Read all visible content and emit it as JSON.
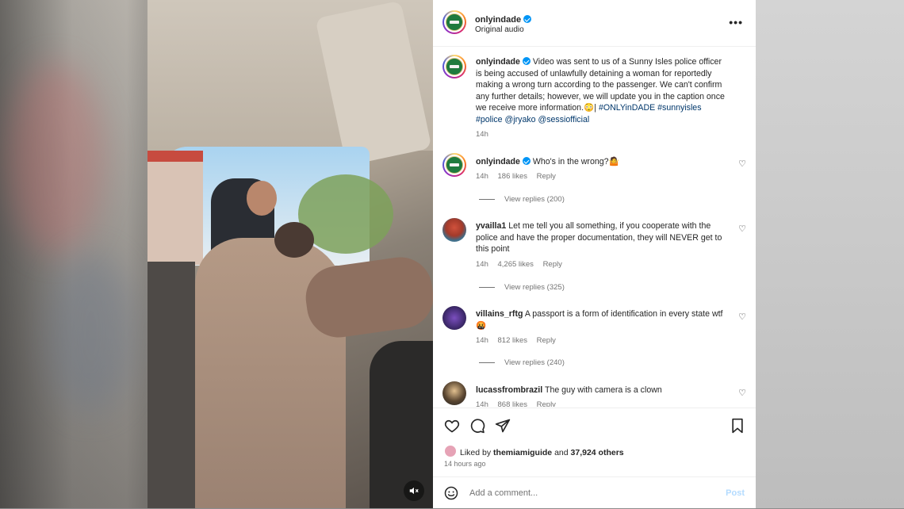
{
  "post": {
    "username": "onlyindade",
    "audio": "Original audio",
    "caption_user": "onlyindade",
    "caption_text": "Video was sent to us of a Sunny Isles police officer is being accused of unlawfully detaining a woman for reportedly making a wrong turn according to the passenger. We can't confirm any further details; however, we will update you in the caption once we receive more information.",
    "caption_emoji": "😳",
    "caption_sep": "|",
    "caption_tags": "#ONLYinDADE",
    "caption_tags2": "#sunnyisles #police @jryako @sessiofficial",
    "caption_time": "14h"
  },
  "comments": [
    {
      "user": "onlyindade",
      "verified": true,
      "text": "Who's in the wrong?🤷",
      "time": "14h",
      "likes": "186 likes",
      "reply": "Reply",
      "view_replies": "View replies (200)"
    },
    {
      "user": "yvailla1",
      "verified": false,
      "text": "Let me tell you all something, if you cooperate with the police and have the proper documentation, they will NEVER get to this point",
      "time": "14h",
      "likes": "4,265 likes",
      "reply": "Reply",
      "view_replies": "View replies (325)"
    },
    {
      "user": "villains_rftg",
      "verified": false,
      "text": "A passport is a form of identification in every state wtf 🤬",
      "time": "14h",
      "likes": "812 likes",
      "reply": "Reply",
      "view_replies": "View replies (240)"
    },
    {
      "user": "lucassfrombrazil",
      "verified": false,
      "text": "The guy with camera is a clown",
      "time": "14h",
      "likes": "868 likes",
      "reply": "Reply"
    }
  ],
  "likes": {
    "prefix": "Liked by",
    "user": "themiamiguide",
    "and": "and",
    "others": "37,924 others"
  },
  "posted": "14 hours ago",
  "add_comment": {
    "placeholder": "Add a comment...",
    "post": "Post"
  },
  "icons": {
    "more": "more-options-icon",
    "like": "heart-icon",
    "comment": "comment-icon",
    "share": "paper-plane-icon",
    "save": "bookmark-icon",
    "mute": "speaker-muted-icon",
    "emoji": "emoji-icon"
  },
  "colors": {
    "verified": "#0095f6",
    "link": "#00376b",
    "post_disabled": "#b3dbff"
  }
}
